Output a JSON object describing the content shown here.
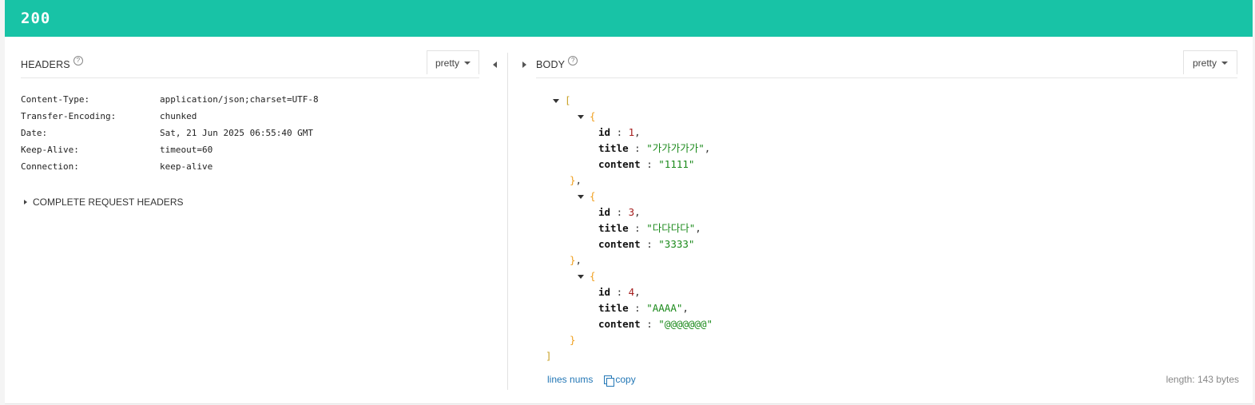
{
  "status": {
    "code": "200",
    "color": "#18c3a6"
  },
  "headers_panel": {
    "title": "HEADERS",
    "help_icon": "?",
    "format": "pretty",
    "rows": [
      {
        "key": "Content-Type:",
        "value": "application/json;charset=UTF-8"
      },
      {
        "key": "Transfer-Encoding:",
        "value": "chunked"
      },
      {
        "key": "Date:",
        "value": "Sat, 21 Jun 2025 06:55:40 GMT"
      },
      {
        "key": "Keep-Alive:",
        "value": "timeout=60"
      },
      {
        "key": "Connection:",
        "value": "keep-alive"
      }
    ],
    "complete_request_headers": "COMPLETE REQUEST HEADERS"
  },
  "body_panel": {
    "title": "BODY",
    "help_icon": "?",
    "format": "pretty",
    "items": [
      {
        "id": "1",
        "title": "\"가가가가가\"",
        "content": "\"1111\""
      },
      {
        "id": "3",
        "title": "\"다다다다\"",
        "content": "\"3333\""
      },
      {
        "id": "4",
        "title": "\"AAAA\"",
        "content": "\"@@@@@@@\""
      }
    ],
    "keys": {
      "id": "id",
      "title": "title",
      "content": "content"
    },
    "lines_nums": "lines nums",
    "copy": "copy",
    "length": "length: 143 bytes"
  }
}
